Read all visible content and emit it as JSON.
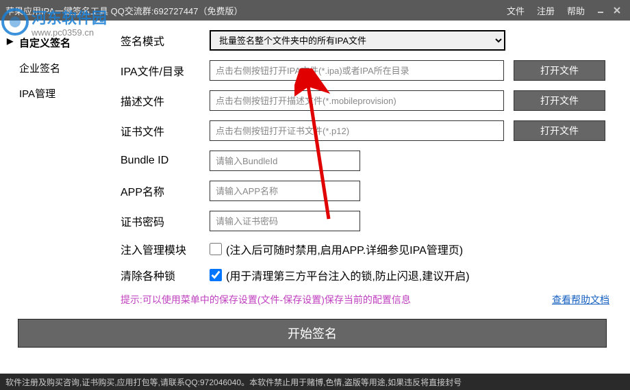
{
  "window": {
    "title": "苹果应用IPA一键签名工具 QQ交流群:692727447（免费版）",
    "menus": [
      "文件",
      "注册",
      "帮助"
    ]
  },
  "watermark": {
    "site_name": "河东软件园",
    "site_url": "www.pc0359.cn"
  },
  "sidebar": {
    "items": [
      {
        "label": "自定义签名",
        "active": true
      },
      {
        "label": "企业签名",
        "active": false
      },
      {
        "label": "IPA管理",
        "active": false
      }
    ]
  },
  "form": {
    "sign_mode": {
      "label": "签名模式",
      "value": "批量签名整个文件夹中的所有IPA文件"
    },
    "ipa_path": {
      "label": "IPA文件/目录",
      "placeholder": "点击右侧按钮打开IPA文件(*.ipa)或者IPA所在目录",
      "button": "打开文件"
    },
    "desc_file": {
      "label": "描述文件",
      "placeholder": "点击右侧按钮打开描述文件(*.mobileprovision)",
      "button": "打开文件"
    },
    "cert_file": {
      "label": "证书文件",
      "placeholder": "点击右侧按钮打开证书文件(*.p12)",
      "button": "打开文件"
    },
    "bundle_id": {
      "label": "Bundle ID",
      "placeholder": "请输入BundleId"
    },
    "app_name": {
      "label": "APP名称",
      "placeholder": "请输入APP名称"
    },
    "cert_pwd": {
      "label": "证书密码",
      "placeholder": "请输入证书密码"
    },
    "inject": {
      "label": "注入管理模块",
      "checked": false,
      "note": "(注入后可随时禁用,启用APP.详细参见IPA管理页)"
    },
    "clear_locks": {
      "label": "清除各种锁",
      "checked": true,
      "note": "(用于清理第三方平台注入的锁,防止闪退,建议开启)"
    },
    "hint": "提示:可以使用菜单中的保存设置(文件-保存设置)保存当前的配置信息",
    "help_link": "查看帮助文档",
    "start_button": "开始签名"
  },
  "statusbar": "软件注册及购买咨询,证书购买,应用打包等,请联系QQ:972046040。本软件禁止用于赌博,色情,盗版等用途,如果违反将直接封号"
}
